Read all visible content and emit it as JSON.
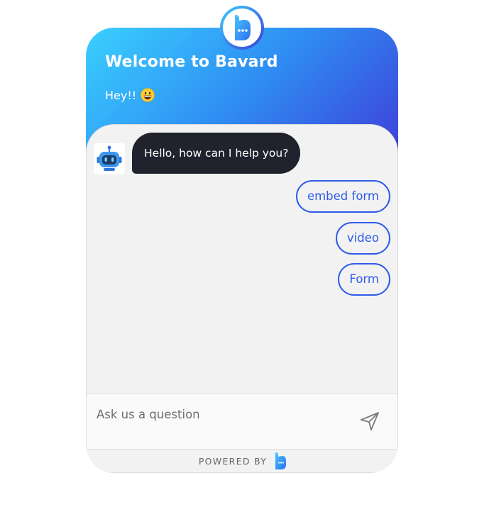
{
  "header": {
    "title": "Welcome to Bavard",
    "subtitle": "Hey!!"
  },
  "chat": {
    "bot_message": "Hello, how can I help you?",
    "quick_replies": [
      "embed form",
      "video",
      "Form"
    ]
  },
  "composer": {
    "placeholder": "Ask us a question"
  },
  "footer": {
    "powered_by": "POWERED BY"
  },
  "icons": {
    "logo": "bavard-logo-icon",
    "emoji": "grinning-face-emoji-icon",
    "avatar": "robot-icon",
    "send": "paper-plane-send-icon"
  },
  "colors": {
    "gradient_start": "#3ad0ff",
    "gradient_end": "#3f3bd8",
    "bot_bubble": "#20232d",
    "accent": "#2f5bea",
    "panel_bg": "#f2f2f2"
  }
}
